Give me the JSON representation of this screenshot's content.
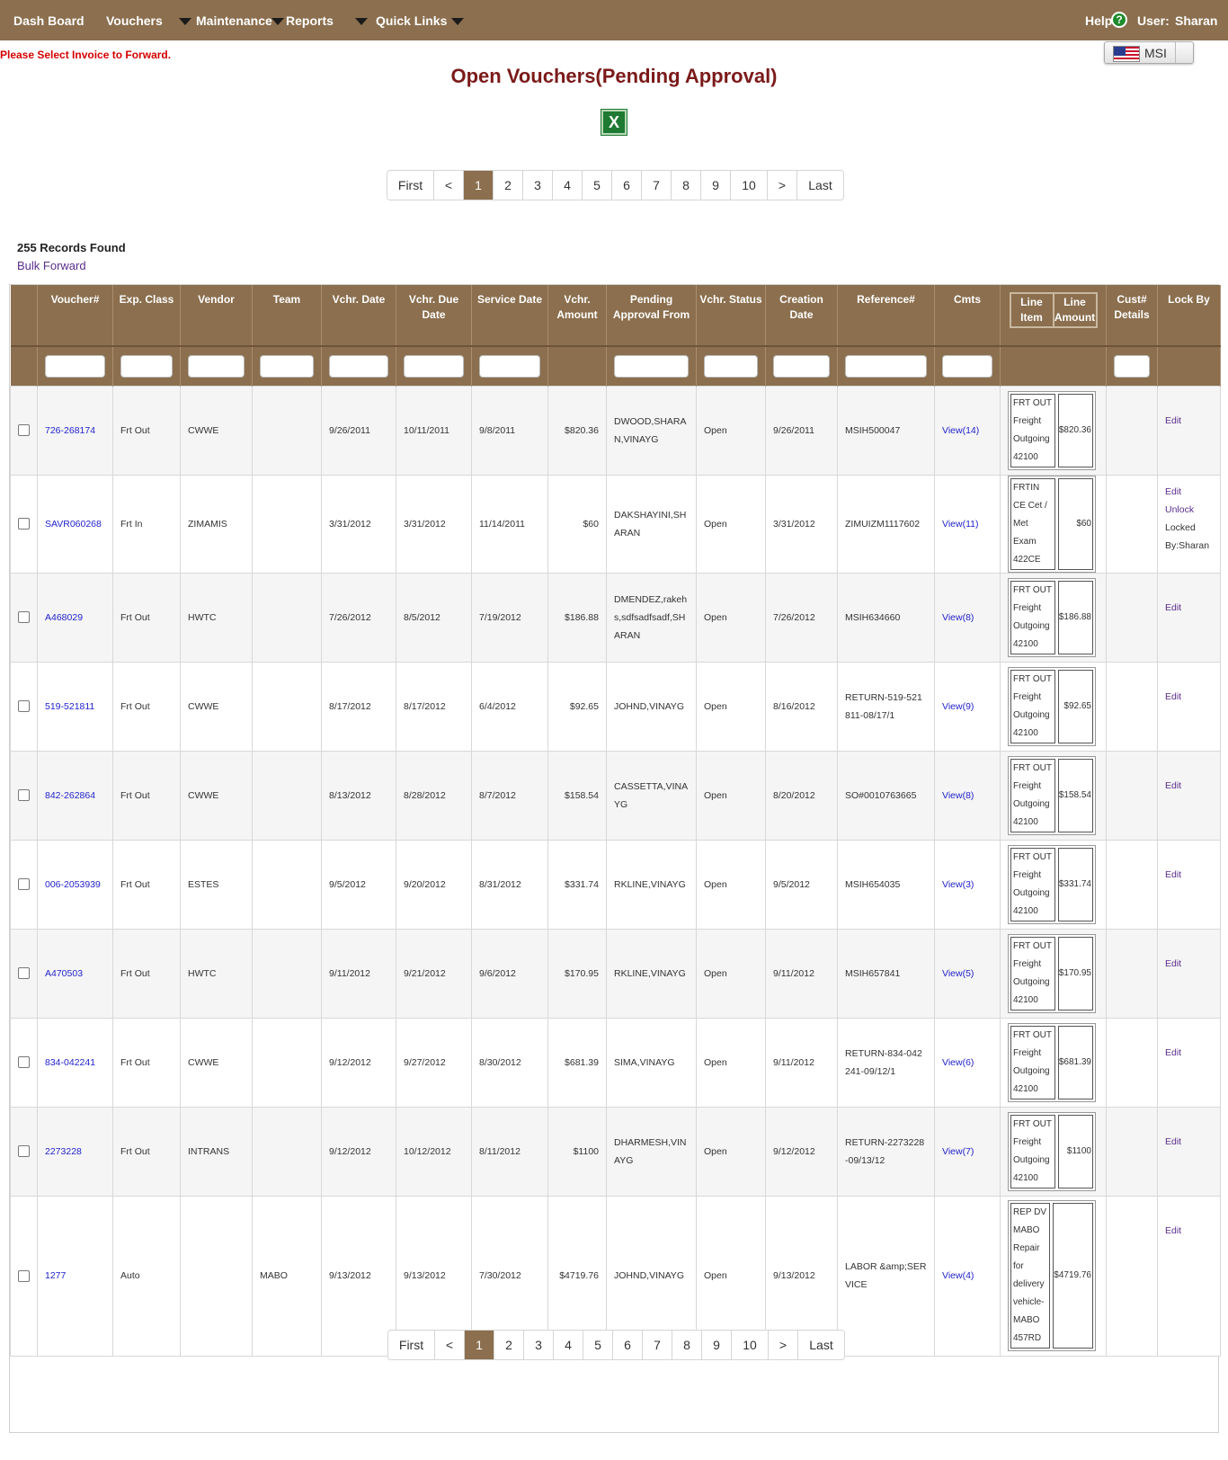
{
  "nav": {
    "dashboard": "Dash Board",
    "vouchers": "Vouchers",
    "maintenance": "Maintenance",
    "reports": "Reports",
    "quick_links": "Quick Links",
    "help": "Help",
    "user_label": "User:",
    "user_name": "Sharan"
  },
  "message": "Please Select Invoice to Forward.",
  "language": "MSI",
  "page_title": "Open Vouchers(Pending Approval)",
  "pager": {
    "first": "First",
    "prev": "<",
    "pages": [
      "1",
      "2",
      "3",
      "4",
      "5",
      "6",
      "7",
      "8",
      "9",
      "10"
    ],
    "next": ">",
    "last": "Last",
    "current": "1"
  },
  "records_found": "255 Records Found",
  "bulk_forward": "Bulk Forward",
  "columns": {
    "voucher": "Voucher#",
    "exp_class": "Exp. Class",
    "vendor": "Vendor",
    "team": "Team",
    "vchr_date": "Vchr. Date",
    "vchr_due_date": "Vchr. Due Date",
    "service_date": "Service Date",
    "vchr_amount": "Vchr. Amount",
    "pending_from": "Pending Approval From",
    "vchr_status": "Vchr. Status",
    "creation_date": "Creation Date",
    "reference": "Reference#",
    "cmts": "Cmts",
    "line_item": "Line Item",
    "line_amount": "Line Amount",
    "cust_details": "Cust# Details",
    "lock_by": "Lock By"
  },
  "rows": [
    {
      "voucher": "726-268174",
      "exp": "Frt Out",
      "vendor": "CWWE",
      "team": "",
      "vdate": "9/26/2011",
      "due": "10/11/2011",
      "svc": "9/8/2011",
      "amt": "$820.36",
      "pending": "DWOOD,SHARAN,VINAYG",
      "status": "Open",
      "created": "9/26/2011",
      "ref": "MSIH500047",
      "cmts": "View(14)",
      "li_desc": "FRT OUT Freight Outgoing 42100",
      "li_amt": "$820.36",
      "cust": "",
      "lock": "Edit"
    },
    {
      "voucher": "SAVR060268",
      "exp": "Frt In",
      "vendor": "ZIMAMIS",
      "team": "",
      "vdate": "3/31/2012",
      "due": "3/31/2012",
      "svc": "11/14/2011",
      "amt": "$60",
      "pending": "DAKSHAYINI,SHARAN",
      "status": "Open",
      "created": "3/31/2012",
      "ref": "ZIMUIZM1117602",
      "cmts": "View(11)",
      "li_desc": "FRTIN CE Cet / Met Exam 422CE",
      "li_amt": "$60",
      "cust": "",
      "lock": "Edit Unlock Locked By:Sharan"
    },
    {
      "voucher": "A468029",
      "exp": "Frt Out",
      "vendor": "HWTC",
      "team": "",
      "vdate": "7/26/2012",
      "due": "8/5/2012",
      "svc": "7/19/2012",
      "amt": "$186.88",
      "pending": "DMENDEZ,rakehs,sdfsadfsadf,SHARAN",
      "status": "Open",
      "created": "7/26/2012",
      "ref": "MSIH634660",
      "cmts": "View(8)",
      "li_desc": "FRT OUT Freight Outgoing 42100",
      "li_amt": "$186.88",
      "cust": "",
      "lock": "Edit"
    },
    {
      "voucher": "519-521811",
      "exp": "Frt Out",
      "vendor": "CWWE",
      "team": "",
      "vdate": "8/17/2012",
      "due": "8/17/2012",
      "svc": "6/4/2012",
      "amt": "$92.65",
      "pending": "JOHND,VINAYG",
      "status": "Open",
      "created": "8/16/2012",
      "ref": "RETURN-519-521811-08/17/1",
      "cmts": "View(9)",
      "li_desc": "FRT OUT Freight Outgoing 42100",
      "li_amt": "$92.65",
      "cust": "",
      "lock": "Edit"
    },
    {
      "voucher": "842-262864",
      "exp": "Frt Out",
      "vendor": "CWWE",
      "team": "",
      "vdate": "8/13/2012",
      "due": "8/28/2012",
      "svc": "8/7/2012",
      "amt": "$158.54",
      "pending": "CASSETTA,VINAYG",
      "status": "Open",
      "created": "8/20/2012",
      "ref": "SO#0010763665",
      "cmts": "View(8)",
      "li_desc": "FRT OUT Freight Outgoing 42100",
      "li_amt": "$158.54",
      "cust": "",
      "lock": "Edit"
    },
    {
      "voucher": "006-2053939",
      "exp": "Frt Out",
      "vendor": "ESTES",
      "team": "",
      "vdate": "9/5/2012",
      "due": "9/20/2012",
      "svc": "8/31/2012",
      "amt": "$331.74",
      "pending": "RKLINE,VINAYG",
      "status": "Open",
      "created": "9/5/2012",
      "ref": "MSIH654035",
      "cmts": "View(3)",
      "li_desc": "FRT OUT Freight Outgoing 42100",
      "li_amt": "$331.74",
      "cust": "",
      "lock": "Edit"
    },
    {
      "voucher": "A470503",
      "exp": "Frt Out",
      "vendor": "HWTC",
      "team": "",
      "vdate": "9/11/2012",
      "due": "9/21/2012",
      "svc": "9/6/2012",
      "amt": "$170.95",
      "pending": "RKLINE,VINAYG",
      "status": "Open",
      "created": "9/11/2012",
      "ref": "MSIH657841",
      "cmts": "View(5)",
      "li_desc": "FRT OUT Freight Outgoing 42100",
      "li_amt": "$170.95",
      "cust": "",
      "lock": "Edit"
    },
    {
      "voucher": "834-042241",
      "exp": "Frt Out",
      "vendor": "CWWE",
      "team": "",
      "vdate": "9/12/2012",
      "due": "9/27/2012",
      "svc": "8/30/2012",
      "amt": "$681.39",
      "pending": "SIMA,VINAYG",
      "status": "Open",
      "created": "9/11/2012",
      "ref": "RETURN-834-042241-09/12/1",
      "cmts": "View(6)",
      "li_desc": "FRT OUT Freight Outgoing 42100",
      "li_amt": "$681.39",
      "cust": "",
      "lock": "Edit"
    },
    {
      "voucher": "2273228",
      "exp": "Frt Out",
      "vendor": "INTRANS",
      "team": "",
      "vdate": "9/12/2012",
      "due": "10/12/2012",
      "svc": "8/11/2012",
      "amt": "$1100",
      "pending": "DHARMESH,VINAYG",
      "status": "Open",
      "created": "9/12/2012",
      "ref": "RETURN-2273228-09/13/12",
      "cmts": "View(7)",
      "li_desc": "FRT OUT Freight Outgoing 42100",
      "li_amt": "$1100",
      "cust": "",
      "lock": "Edit"
    },
    {
      "voucher": "1277",
      "exp": "Auto",
      "vendor": "",
      "team": "MABO",
      "vdate": "9/13/2012",
      "due": "9/13/2012",
      "svc": "7/30/2012",
      "amt": "$4719.76",
      "pending": "JOHND,VINAYG",
      "status": "Open",
      "created": "9/13/2012",
      "ref": "LABOR &amp;SERVICE",
      "cmts": "View(4)",
      "li_desc": "REP DV MABO Repair for delivery vehicle-MABO 457RD",
      "li_amt": "$4719.76",
      "cust": "",
      "lock": "Edit"
    }
  ]
}
